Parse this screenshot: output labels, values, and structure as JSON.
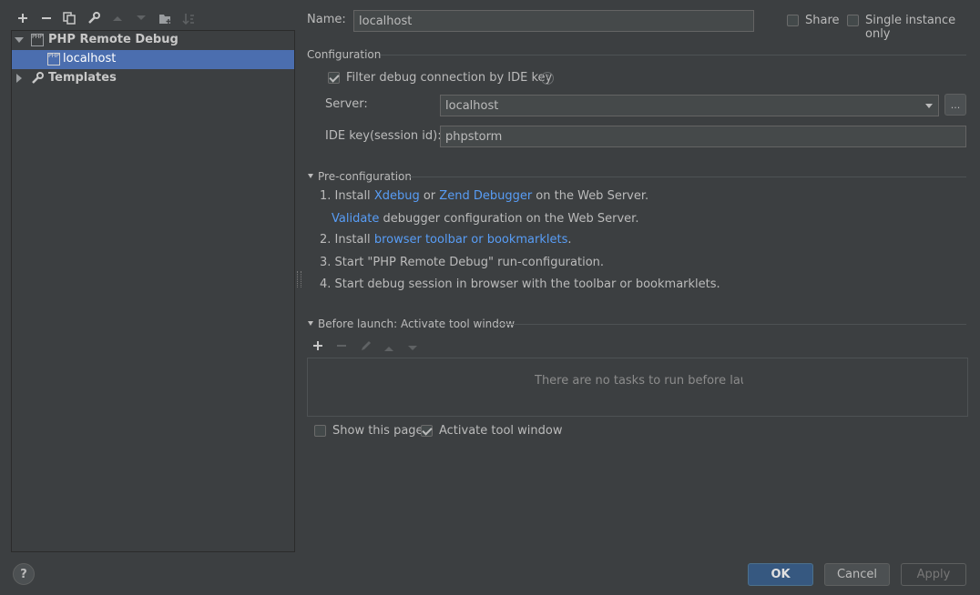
{
  "toolbar": {
    "icons": [
      "plus-icon",
      "minus-icon",
      "copy-icon",
      "wrench-icon",
      "arrow-up-icon",
      "arrow-down-icon",
      "new-folder-icon",
      "sort-icon"
    ]
  },
  "tree": {
    "group_label": "PHP Remote Debug",
    "child_label": "localhost",
    "templates_label": "Templates"
  },
  "name": {
    "label": "Name:",
    "value": "localhost"
  },
  "share": {
    "label": "Share",
    "checked": false
  },
  "single_instance": {
    "label": "Single instance only",
    "checked": false
  },
  "configuration": {
    "title": "Configuration",
    "filter_label": "Filter debug connection by IDE key",
    "filter_checked": true,
    "server_label": "Server:",
    "server_value": "localhost",
    "browse_label": "...",
    "idekey_label": "IDE key(session id):",
    "idekey_value": "phpstorm"
  },
  "preconfig": {
    "title": "Pre-configuration",
    "step1_prefix": "1. Install ",
    "step1_link1": "Xdebug",
    "step1_or": " or ",
    "step1_link2": "Zend Debugger",
    "step1_suffix": " on the Web Server.",
    "validate_link": "Validate",
    "validate_suffix": " debugger configuration on the Web Server.",
    "step2_prefix": "2. Install ",
    "step2_link": "browser toolbar or bookmarklets",
    "step2_suffix": ".",
    "step3": "3. Start \"PHP Remote Debug\" run-configuration.",
    "step4": "4. Start debug session in browser with the toolbar or bookmarklets."
  },
  "before_launch": {
    "title": "Before launch: Activate tool window",
    "empty_text": "There are no tasks to run before launch",
    "show_page_label": "Show this page",
    "show_page_checked": false,
    "activate_label": "Activate tool window",
    "activate_checked": true
  },
  "buttons": {
    "ok": "OK",
    "cancel": "Cancel",
    "apply": "Apply"
  },
  "help": {
    "label": "?"
  },
  "colors": {
    "background": "#3c3f41",
    "selection": "#4b6eaf",
    "link": "#589df6",
    "primary": "#365880"
  }
}
